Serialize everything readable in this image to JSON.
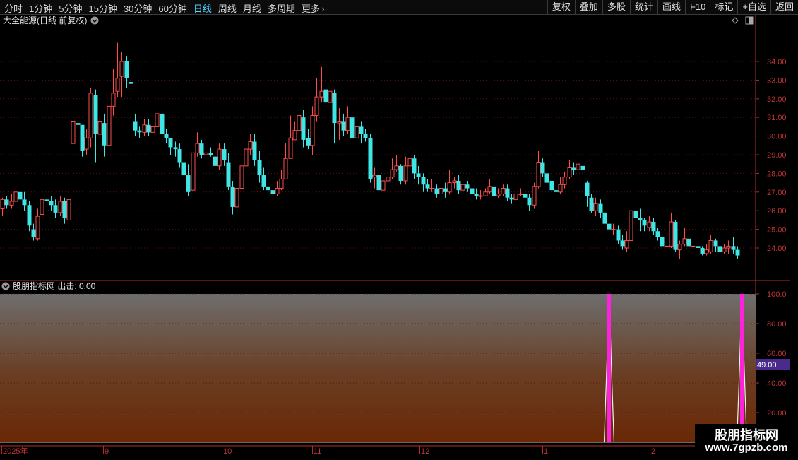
{
  "toolbar": {
    "periods": [
      "分时",
      "1分钟",
      "5分钟",
      "15分钟",
      "30分钟",
      "60分钟",
      "日线",
      "周线",
      "月线",
      "多周期"
    ],
    "active_period": "日线",
    "more_label": "更多",
    "right_buttons": [
      "复权",
      "叠加",
      "多股",
      "统计",
      "画线",
      "F10",
      "标记",
      "+自选",
      "返回"
    ]
  },
  "main_panel": {
    "title": "大全能源(日线 前复权)",
    "price_ticks": [
      "34.00",
      "33.00",
      "32.00",
      "31.00",
      "30.00",
      "29.00",
      "28.00",
      "27.00",
      "26.00",
      "25.00",
      "24.00"
    ]
  },
  "indicator_panel": {
    "title": "股朋指标网 出击: 0.00",
    "ticks": [
      "100.0",
      "80.00",
      "60.00",
      "40.00",
      "20.00"
    ],
    "cursor_value": "49.00"
  },
  "date_axis": {
    "labels": [
      "2025年",
      "9",
      "10",
      "11",
      "12",
      "1",
      "2"
    ]
  },
  "watermark": {
    "line1": "股朋指标网",
    "line2": "www.7gpzb.com"
  },
  "colors": {
    "up": "#ff4d4d",
    "down": "#3fe6e6",
    "signal": "#ff22dd",
    "active_tab": "#4fd6ff",
    "axis": "#c03434"
  },
  "chart_data": {
    "type": "candlestick",
    "ylim": [
      23.0,
      35.0
    ],
    "candles": [
      [
        26.1,
        26.6,
        26.7,
        25.7
      ],
      [
        26.6,
        26.3,
        26.8,
        26.1
      ],
      [
        26.3,
        26.5,
        26.9,
        26.1
      ],
      [
        26.5,
        27.0,
        27.1,
        26.3
      ],
      [
        27.0,
        26.6,
        27.3,
        26.4
      ],
      [
        26.6,
        26.3,
        27.0,
        26.0
      ],
      [
        26.3,
        25.2,
        26.5,
        24.9
      ],
      [
        25.0,
        24.6,
        25.3,
        24.4
      ],
      [
        24.5,
        25.7,
        26.1,
        24.4
      ],
      [
        25.8,
        26.6,
        26.8,
        25.6
      ],
      [
        26.6,
        26.5,
        26.9,
        26.2
      ],
      [
        26.5,
        26.3,
        26.8,
        26.0
      ],
      [
        26.3,
        25.9,
        26.6,
        25.6
      ],
      [
        25.9,
        26.5,
        26.8,
        25.7
      ],
      [
        26.5,
        25.6,
        26.7,
        25.3
      ],
      [
        25.5,
        26.6,
        27.3,
        25.3
      ],
      [
        29.6,
        30.8,
        31.5,
        29.1
      ],
      [
        30.7,
        30.6,
        31.0,
        29.2
      ],
      [
        30.6,
        29.2,
        30.5,
        28.9
      ],
      [
        29.3,
        29.9,
        30.4,
        29.0
      ],
      [
        29.9,
        32.3,
        32.6,
        29.4
      ],
      [
        32.2,
        30.1,
        32.5,
        28.6
      ],
      [
        30.1,
        30.8,
        31.6,
        29.0
      ],
      [
        30.7,
        29.5,
        31.2,
        28.9
      ],
      [
        29.5,
        31.6,
        32.6,
        29.2
      ],
      [
        31.6,
        32.3,
        33.6,
        31.1
      ],
      [
        32.4,
        33.1,
        35.0,
        32.1
      ],
      [
        33.2,
        34.0,
        34.5,
        32.1
      ],
      [
        34.0,
        33.1,
        34.3,
        32.6
      ],
      [
        32.9,
        32.8,
        33.0,
        32.5
      ],
      [
        30.8,
        30.3,
        31.2,
        30.0
      ],
      [
        30.3,
        30.2,
        30.5,
        29.9
      ],
      [
        30.2,
        30.6,
        30.9,
        30.0
      ],
      [
        30.6,
        30.2,
        30.9,
        30.0
      ],
      [
        30.2,
        30.5,
        31.4,
        30.1
      ],
      [
        30.5,
        31.2,
        31.6,
        30.4
      ],
      [
        31.2,
        30.1,
        31.3,
        29.9
      ],
      [
        30.1,
        29.9,
        30.4,
        29.6
      ],
      [
        29.9,
        29.4,
        29.9,
        29.0
      ],
      [
        29.4,
        29.3,
        29.7,
        28.9
      ],
      [
        29.3,
        28.6,
        29.6,
        28.3
      ],
      [
        28.6,
        27.9,
        29.0,
        27.5
      ],
      [
        27.9,
        27.0,
        28.5,
        26.8
      ],
      [
        27.1,
        29.1,
        29.4,
        26.6
      ],
      [
        29.1,
        29.6,
        30.2,
        28.9
      ],
      [
        29.6,
        29.0,
        29.8,
        28.8
      ],
      [
        29.0,
        29.1,
        29.6,
        28.8
      ],
      [
        29.1,
        29.0,
        29.4,
        28.9
      ],
      [
        28.9,
        28.4,
        29.2,
        28.1
      ],
      [
        28.4,
        29.3,
        29.6,
        28.2
      ],
      [
        29.3,
        28.7,
        29.6,
        28.4
      ],
      [
        28.6,
        27.3,
        29.1,
        27.1
      ],
      [
        27.3,
        26.2,
        27.6,
        25.8
      ],
      [
        26.2,
        27.2,
        27.6,
        26.0
      ],
      [
        27.2,
        28.4,
        28.9,
        27.0
      ],
      [
        28.4,
        29.3,
        29.7,
        28.0
      ],
      [
        29.3,
        29.7,
        30.1,
        29.0
      ],
      [
        29.7,
        28.7,
        30.1,
        28.4
      ],
      [
        28.7,
        27.9,
        29.2,
        27.5
      ],
      [
        27.9,
        27.3,
        28.3,
        27.1
      ],
      [
        27.3,
        27.1,
        27.5,
        26.8
      ],
      [
        27.1,
        26.9,
        27.3,
        26.5
      ],
      [
        26.9,
        27.2,
        27.6,
        26.8
      ],
      [
        27.2,
        27.7,
        28.2,
        27.1
      ],
      [
        27.7,
        28.8,
        29.6,
        28.0
      ],
      [
        28.8,
        29.9,
        31.1,
        28.8
      ],
      [
        29.8,
        30.3,
        30.8,
        29.9
      ],
      [
        30.3,
        31.1,
        31.5,
        30.1
      ],
      [
        31.0,
        29.8,
        31.4,
        29.4
      ],
      [
        29.9,
        29.5,
        30.4,
        29.3
      ],
      [
        29.5,
        31.1,
        31.6,
        29.0
      ],
      [
        31.1,
        32.1,
        33.1,
        30.8
      ],
      [
        32.1,
        32.4,
        33.7,
        31.8
      ],
      [
        32.5,
        31.8,
        33.7,
        31.6
      ],
      [
        31.8,
        32.4,
        33.2,
        31.5
      ],
      [
        32.3,
        30.7,
        32.5,
        29.6
      ],
      [
        30.7,
        30.8,
        31.5,
        29.8
      ],
      [
        30.8,
        30.3,
        31.2,
        30.0
      ],
      [
        30.3,
        31.0,
        31.6,
        30.1
      ],
      [
        31.0,
        29.9,
        31.2,
        29.7
      ],
      [
        29.9,
        30.5,
        30.8,
        29.8
      ],
      [
        30.5,
        30.1,
        30.8,
        29.6
      ],
      [
        30.1,
        29.9,
        30.4,
        29.7
      ],
      [
        29.9,
        27.7,
        30.1,
        27.5
      ],
      [
        27.8,
        27.9,
        28.3,
        27.2
      ],
      [
        27.9,
        27.1,
        28.1,
        26.8
      ],
      [
        27.1,
        27.6,
        28.1,
        27.0
      ],
      [
        27.6,
        27.8,
        28.3,
        27.4
      ],
      [
        27.8,
        28.2,
        28.8,
        27.7
      ],
      [
        28.2,
        28.4,
        29.0,
        28.1
      ],
      [
        28.4,
        27.6,
        28.5,
        27.4
      ],
      [
        27.6,
        28.4,
        28.9,
        27.4
      ],
      [
        28.4,
        28.8,
        29.4,
        28.3
      ],
      [
        28.8,
        28.0,
        29.0,
        27.7
      ],
      [
        28.0,
        27.8,
        28.4,
        27.4
      ],
      [
        27.8,
        27.4,
        28.0,
        27.0
      ],
      [
        27.4,
        27.2,
        27.7,
        27.0
      ],
      [
        27.2,
        27.2,
        27.7,
        27.0
      ],
      [
        27.2,
        26.9,
        27.4,
        26.7
      ],
      [
        26.9,
        27.2,
        27.5,
        26.8
      ],
      [
        27.2,
        27.0,
        27.5,
        26.7
      ],
      [
        27.0,
        27.5,
        28.2,
        26.9
      ],
      [
        27.5,
        27.6,
        27.8,
        27.2
      ],
      [
        27.6,
        27.1,
        27.9,
        26.9
      ],
      [
        27.1,
        27.4,
        27.7,
        27.0
      ],
      [
        27.4,
        27.2,
        27.6,
        27.0
      ],
      [
        27.2,
        26.9,
        27.5,
        26.8
      ],
      [
        26.9,
        26.8,
        27.2,
        26.6
      ],
      [
        26.8,
        26.8,
        27.1,
        26.6
      ],
      [
        26.8,
        27.0,
        27.2,
        26.8
      ],
      [
        27.0,
        27.3,
        27.7,
        26.9
      ],
      [
        27.3,
        26.8,
        27.4,
        26.6
      ],
      [
        26.8,
        26.9,
        27.2,
        26.7
      ],
      [
        26.9,
        27.2,
        27.4,
        26.8
      ],
      [
        27.2,
        26.7,
        27.4,
        26.5
      ],
      [
        26.7,
        26.6,
        26.9,
        26.4
      ],
      [
        26.6,
        26.9,
        27.1,
        26.5
      ],
      [
        26.9,
        26.9,
        27.2,
        26.8
      ],
      [
        26.9,
        26.7,
        27.1,
        26.5
      ],
      [
        26.7,
        26.3,
        26.9,
        26.0
      ],
      [
        26.3,
        27.3,
        27.5,
        26.1
      ],
      [
        27.3,
        28.6,
        29.2,
        27.2
      ],
      [
        28.6,
        28.0,
        28.8,
        27.8
      ],
      [
        28.0,
        27.5,
        28.3,
        27.2
      ],
      [
        27.6,
        27.1,
        27.8,
        26.9
      ],
      [
        27.1,
        27.0,
        27.5,
        26.8
      ],
      [
        27.0,
        27.4,
        27.8,
        26.9
      ],
      [
        27.4,
        27.8,
        28.1,
        27.2
      ],
      [
        27.8,
        28.3,
        28.7,
        27.7
      ],
      [
        28.3,
        28.2,
        28.6,
        27.9
      ],
      [
        28.2,
        28.5,
        28.9,
        28.0
      ],
      [
        28.4,
        28.2,
        28.9,
        28.0
      ],
      [
        27.5,
        26.8,
        27.6,
        26.2
      ],
      [
        26.7,
        26.0,
        26.9,
        25.9
      ],
      [
        26.0,
        26.4,
        26.7,
        25.7
      ],
      [
        26.4,
        25.9,
        26.6,
        25.6
      ],
      [
        25.9,
        25.3,
        26.2,
        25.1
      ],
      [
        25.3,
        25.0,
        25.5,
        24.8
      ],
      [
        25.0,
        25.0,
        25.3,
        24.7
      ],
      [
        25.0,
        24.4,
        25.2,
        24.2
      ],
      [
        24.4,
        24.1,
        24.7,
        23.9
      ],
      [
        24.0,
        24.4,
        24.9,
        23.8
      ],
      [
        24.4,
        26.0,
        26.9,
        24.3
      ],
      [
        26.0,
        25.6,
        26.9,
        25.4
      ],
      [
        25.6,
        25.5,
        26.1,
        24.9
      ],
      [
        25.5,
        25.2,
        25.6,
        24.9
      ],
      [
        25.1,
        25.4,
        25.7,
        24.9
      ],
      [
        25.4,
        24.9,
        25.6,
        24.7
      ],
      [
        24.9,
        24.6,
        25.1,
        24.4
      ],
      [
        24.6,
        24.1,
        24.8,
        23.8
      ],
      [
        24.1,
        24.1,
        24.6,
        23.9
      ],
      [
        24.1,
        25.4,
        25.9,
        24.0
      ],
      [
        25.4,
        23.9,
        25.5,
        23.8
      ],
      [
        23.9,
        24.2,
        24.4,
        23.4
      ],
      [
        24.2,
        24.5,
        25.1,
        24.1
      ],
      [
        24.5,
        24.1,
        24.7,
        23.9
      ],
      [
        24.1,
        24.1,
        24.3,
        23.9
      ],
      [
        24.1,
        24.0,
        24.2,
        23.8
      ],
      [
        24.0,
        23.7,
        24.1,
        23.6
      ],
      [
        23.7,
        23.9,
        24.2,
        23.6
      ],
      [
        23.8,
        24.4,
        24.7,
        23.7
      ],
      [
        24.4,
        24.1,
        24.5,
        23.8
      ],
      [
        24.1,
        23.8,
        24.4,
        23.6
      ],
      [
        23.8,
        24.0,
        24.2,
        23.7
      ],
      [
        24.0,
        24.1,
        24.4,
        23.7
      ],
      [
        24.1,
        23.9,
        24.6,
        23.7
      ],
      [
        23.9,
        23.6,
        24.1,
        23.4
      ]
    ],
    "indicator": {
      "name": "出击",
      "ylim": [
        0,
        100
      ],
      "signals": [
        {
          "candle_index": 137,
          "value": 100
        },
        {
          "candle_index": 167,
          "value": 100
        }
      ]
    }
  }
}
